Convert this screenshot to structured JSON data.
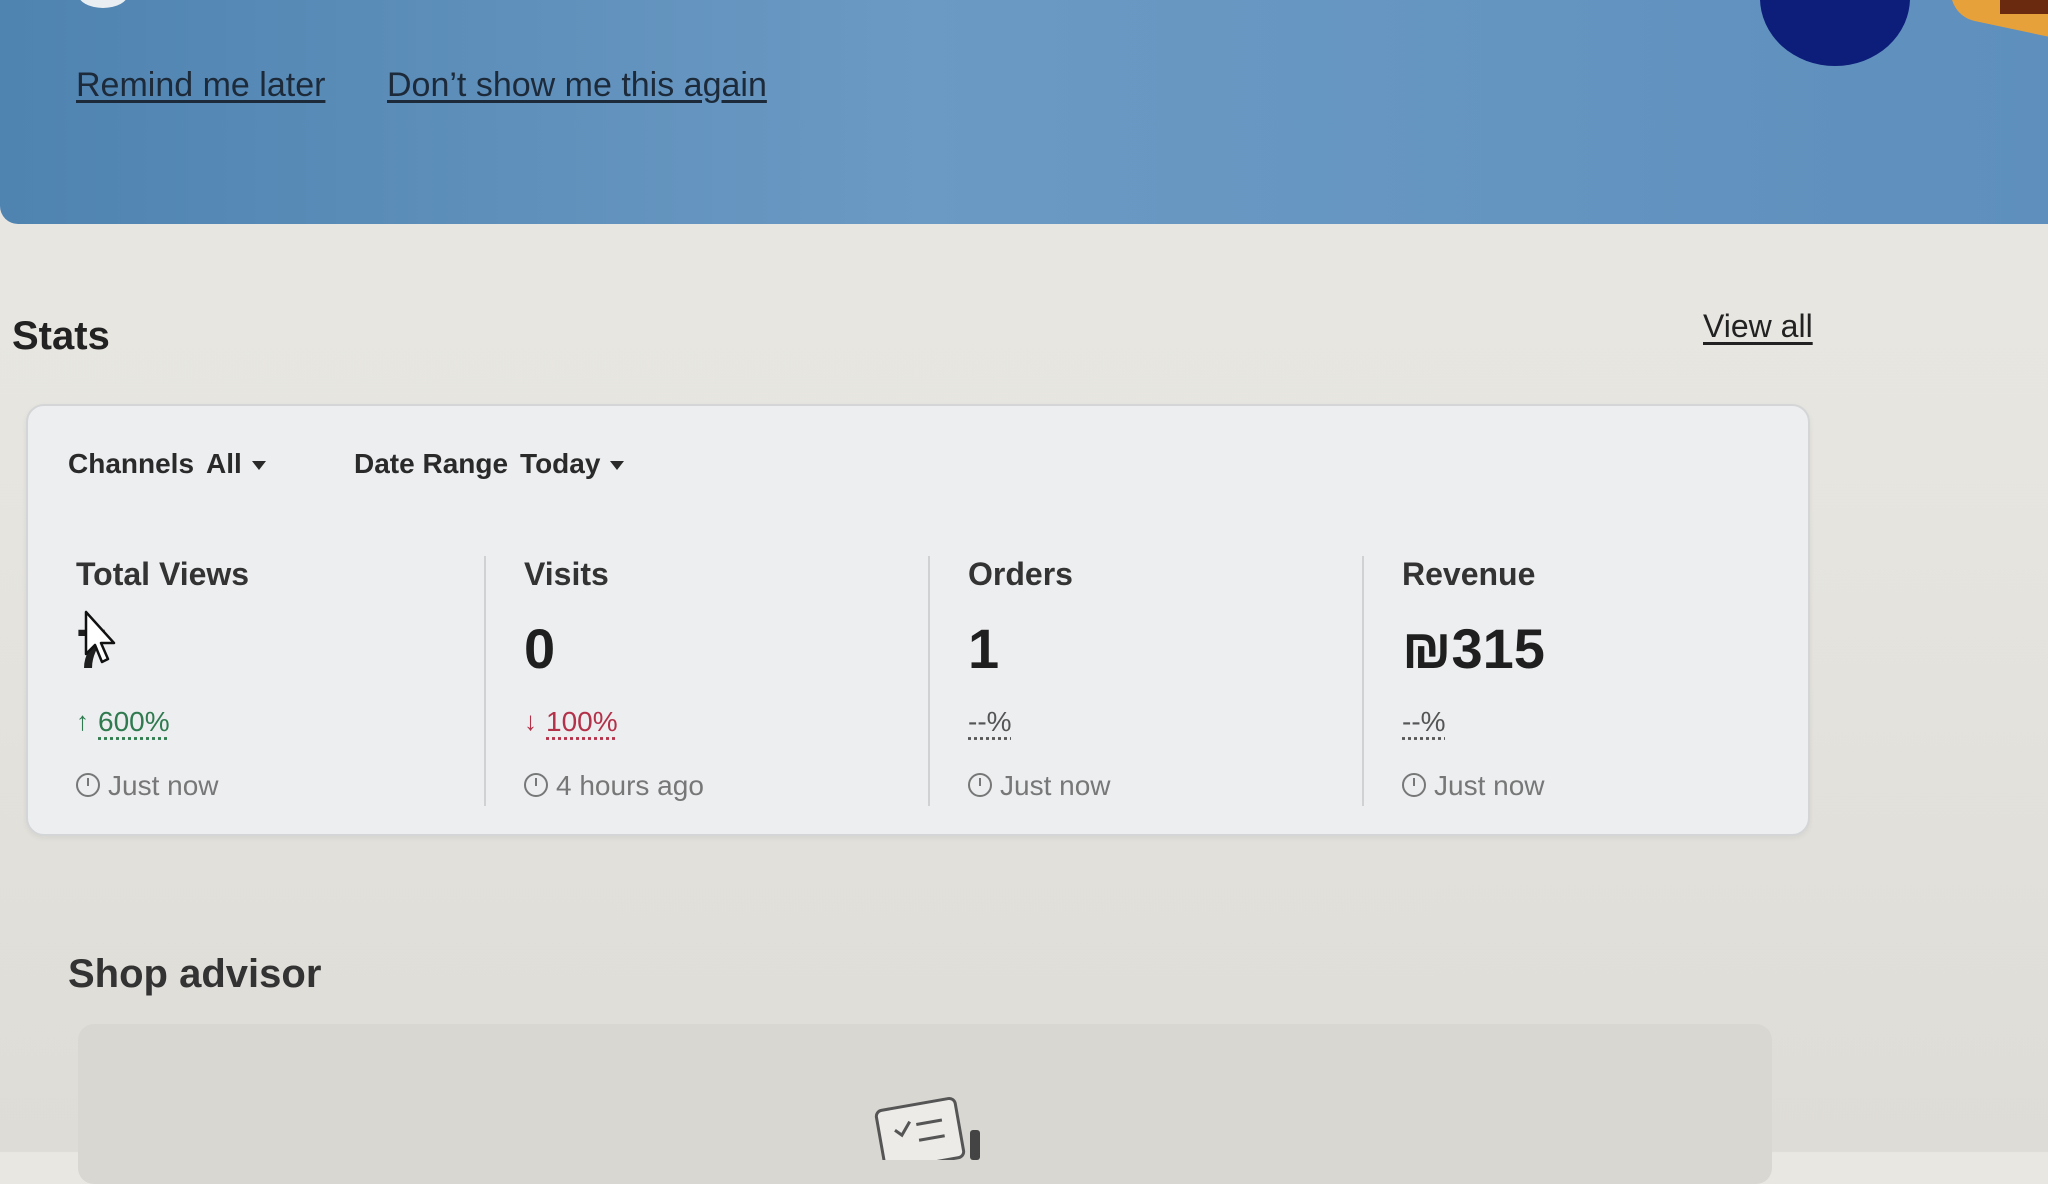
{
  "banner": {
    "remind_label": "Remind me later",
    "dont_show_label": "Don’t show me this again"
  },
  "stats": {
    "title": "Stats",
    "view_all_label": "View all",
    "filters": {
      "channels_label": "Channels",
      "channels_value": "All",
      "date_range_label": "Date Range",
      "date_range_value": "Today"
    },
    "metrics": [
      {
        "title": "Total Views",
        "value": "7",
        "change": "600%",
        "direction": "up",
        "time": "Just now"
      },
      {
        "title": "Visits",
        "value": "0",
        "change": "100%",
        "direction": "down",
        "time": "4 hours ago"
      },
      {
        "title": "Orders",
        "value": "1",
        "change": "--%",
        "direction": "none",
        "time": "Just now"
      },
      {
        "title": "Revenue",
        "value": "₪315",
        "change": "--%",
        "direction": "none",
        "time": "Just now"
      }
    ]
  },
  "shop_advisor": {
    "title": "Shop advisor"
  },
  "colors": {
    "banner": "#5e8fbd",
    "positive": "#2f7a4f",
    "negative": "#b3324a"
  }
}
